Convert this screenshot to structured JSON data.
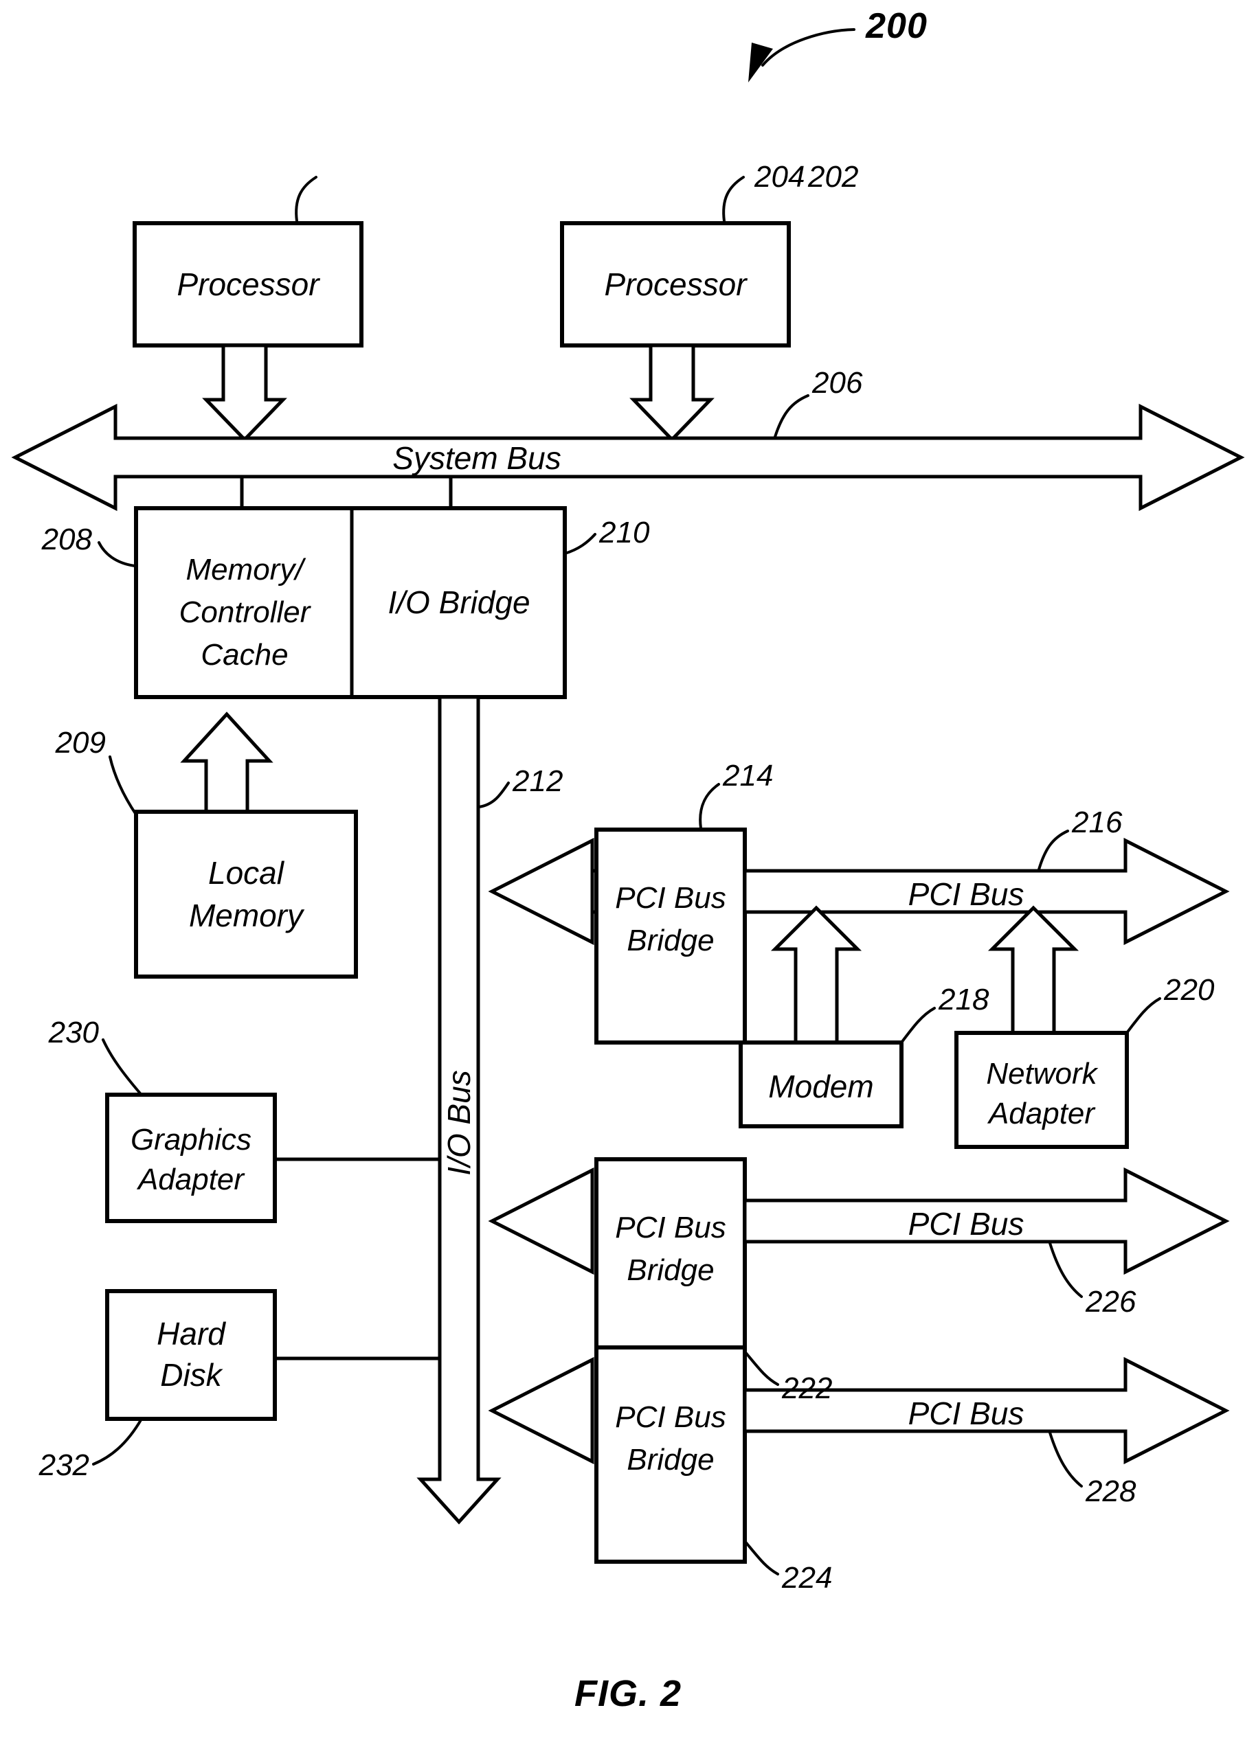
{
  "figure": {
    "caption": "FIG. 2",
    "system_ref": "200"
  },
  "blocks": {
    "processor_1": {
      "label": "Processor",
      "ref": "202"
    },
    "processor_2": {
      "label": "Processor",
      "ref": "204"
    },
    "system_bus": {
      "label": "System Bus",
      "ref": "206"
    },
    "memory_controller_cache": {
      "line1": "Memory/",
      "line2": "Controller",
      "line3": "Cache",
      "ref": "208"
    },
    "io_bridge": {
      "label": "I/O Bridge",
      "ref": "210"
    },
    "local_memory": {
      "line1": "Local",
      "line2": "Memory",
      "ref": "209"
    },
    "io_bus": {
      "label": "I/O Bus",
      "ref": "212"
    },
    "pci_bus_bridge_1": {
      "line1": "PCI Bus",
      "line2": "Bridge",
      "ref": "214"
    },
    "pci_bus_1": {
      "label": "PCI Bus",
      "ref": "216"
    },
    "modem": {
      "label": "Modem",
      "ref": "218"
    },
    "network_adapter": {
      "line1": "Network",
      "line2": "Adapter",
      "ref": "220"
    },
    "pci_bus_bridge_2": {
      "line1": "PCI Bus",
      "line2": "Bridge",
      "ref": "222"
    },
    "pci_bus_2": {
      "label": "PCI Bus",
      "ref": "226"
    },
    "pci_bus_bridge_3": {
      "line1": "PCI Bus",
      "line2": "Bridge",
      "ref": "224"
    },
    "pci_bus_3": {
      "label": "PCI Bus",
      "ref": "228"
    },
    "graphics_adapter": {
      "line1": "Graphics",
      "line2": "Adapter",
      "ref": "230"
    },
    "hard_disk": {
      "line1": "Hard",
      "line2": "Disk",
      "ref": "232"
    }
  },
  "colors": {
    "ink": "#000000",
    "paper": "#ffffff"
  }
}
